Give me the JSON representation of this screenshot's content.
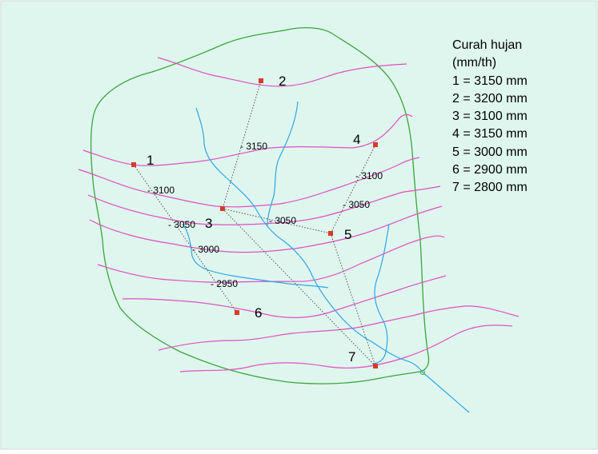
{
  "legend": {
    "title_line1": "Curah hujan",
    "title_line2": "(mm/th)",
    "items": [
      "1 = 3150 mm",
      "2 = 3200 mm",
      "3 = 3100 mm",
      "4 = 3150 mm",
      "5 = 3000 mm",
      "6 = 2900 mm",
      "7 = 2800 mm"
    ]
  },
  "stations": [
    {
      "id": "1",
      "rainfall_mm": 3150
    },
    {
      "id": "2",
      "rainfall_mm": 3200
    },
    {
      "id": "3",
      "rainfall_mm": 3100
    },
    {
      "id": "4",
      "rainfall_mm": 3150
    },
    {
      "id": "5",
      "rainfall_mm": 3000
    },
    {
      "id": "6",
      "rainfall_mm": 2900
    },
    {
      "id": "7",
      "rainfall_mm": 2800
    }
  ],
  "isohyet_labels": [
    "3150",
    "3100",
    "3100",
    "3050",
    "3050",
    "3050",
    "3000",
    "2950"
  ],
  "colors": {
    "background": "#dff6ee",
    "watershed_boundary": "#3aa63a",
    "isohyet": "#e04fbf",
    "river": "#2ea6e8",
    "station": "#d93a2a",
    "triangulation": "#555555"
  }
}
